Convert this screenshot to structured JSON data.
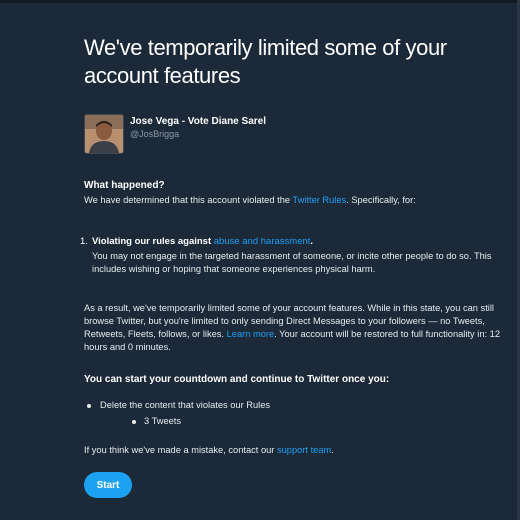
{
  "page": {
    "title": "We've temporarily limited some of your account features"
  },
  "user": {
    "name": "Jose Vega - Vote Diane Sarel",
    "handle": "@JosBrigga"
  },
  "what_happened": {
    "heading": "What happened?",
    "text_before_link": "We have determined that this account violated the ",
    "link": "Twitter Rules",
    "text_after_link": ". Specifically, for:"
  },
  "violation": {
    "number": "1.",
    "title_prefix": "Violating our rules against ",
    "title_link": "abuse and harassment",
    "title_suffix": ".",
    "description": "You may not engage in the targeted harassment of someone, or incite other people to do so. This includes wishing or hoping that someone experiences physical harm."
  },
  "result": {
    "text_before_link": "As a result, we've temporarily limited some of your account features. While in this state, you can still browse Twitter, but you're limited to only sending Direct Messages to your followers — no Tweets, Retweets, Fleets, follows, or likes. ",
    "link": "Learn more",
    "text_after_link": ". Your account will be restored to full functionality in: 12 hours and 0 minutes."
  },
  "countdown": {
    "heading": "You can start your countdown and continue to Twitter once you:",
    "bullet": "Delete the content that violates our Rules",
    "sub_bullet": "3 Tweets"
  },
  "contact": {
    "text_before_link": "If you think we've made a mistake, contact our ",
    "link": "support team",
    "text_after_link": "."
  },
  "start_button": {
    "label": "Start"
  },
  "colors": {
    "background": "#1c2938",
    "accent": "#1da1f2",
    "secondary_text": "#8b98a5"
  }
}
